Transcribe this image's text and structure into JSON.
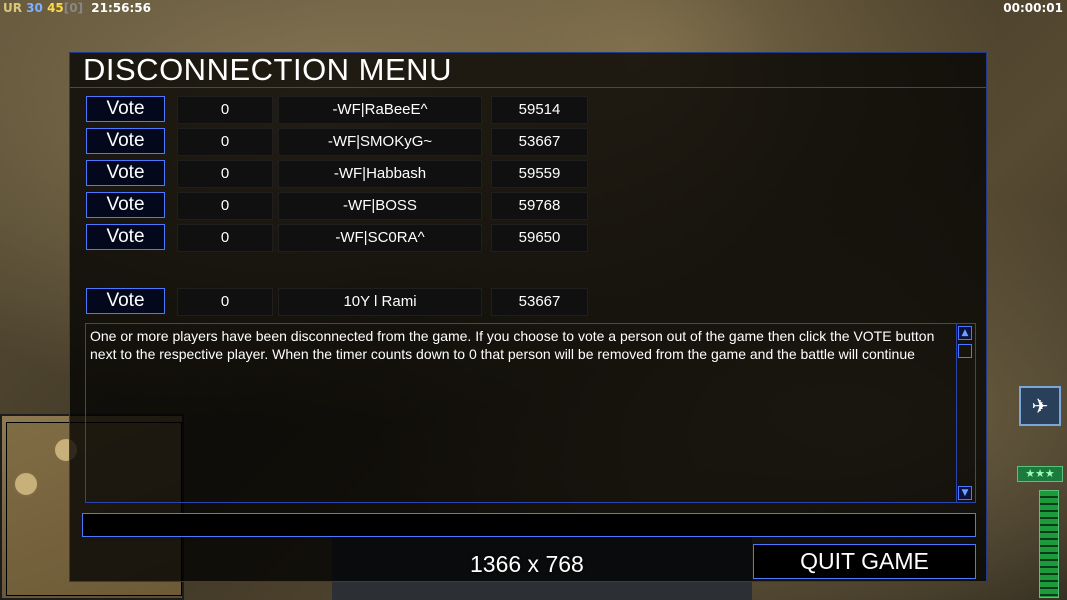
{
  "hud": {
    "faction": "UR",
    "stat1": "30",
    "stat2": "45",
    "stat3": "[0]",
    "clock": "21:56:56",
    "timer": "00:00:01"
  },
  "dialog": {
    "title": "DISCONNECTION MENU",
    "players": [
      {
        "vote_label": "Vote",
        "votes": "0",
        "name": "-WF|RaBeeE^",
        "ping": "59514"
      },
      {
        "vote_label": "Vote",
        "votes": "0",
        "name": "-WF|SMOKyG~",
        "ping": "53667"
      },
      {
        "vote_label": "Vote",
        "votes": "0",
        "name": "-WF|Habbash",
        "ping": "59559"
      },
      {
        "vote_label": "Vote",
        "votes": "0",
        "name": "-WF|BOSS",
        "ping": "59768"
      },
      {
        "vote_label": "Vote",
        "votes": "0",
        "name": "-WF|SC0RA^",
        "ping": "59650"
      }
    ],
    "self_player": {
      "vote_label": "Vote",
      "votes": "0",
      "name": "10Y l Rami",
      "ping": "53667"
    },
    "message": "One or more players have been disconnected from the game. If you choose to vote a person out of the game then click the VOTE button next to the respective player. When the timer counts down to 0 that person will be removed from the game and the battle will continue",
    "chat_value": "",
    "quit_label": "QUIT GAME"
  },
  "overlay": {
    "resolution": "1366 x 768"
  },
  "sidebar": {
    "rank_stars": "★★★"
  },
  "colors": {
    "accent": "#4a78ff",
    "panel_border": "#2a45b0"
  }
}
